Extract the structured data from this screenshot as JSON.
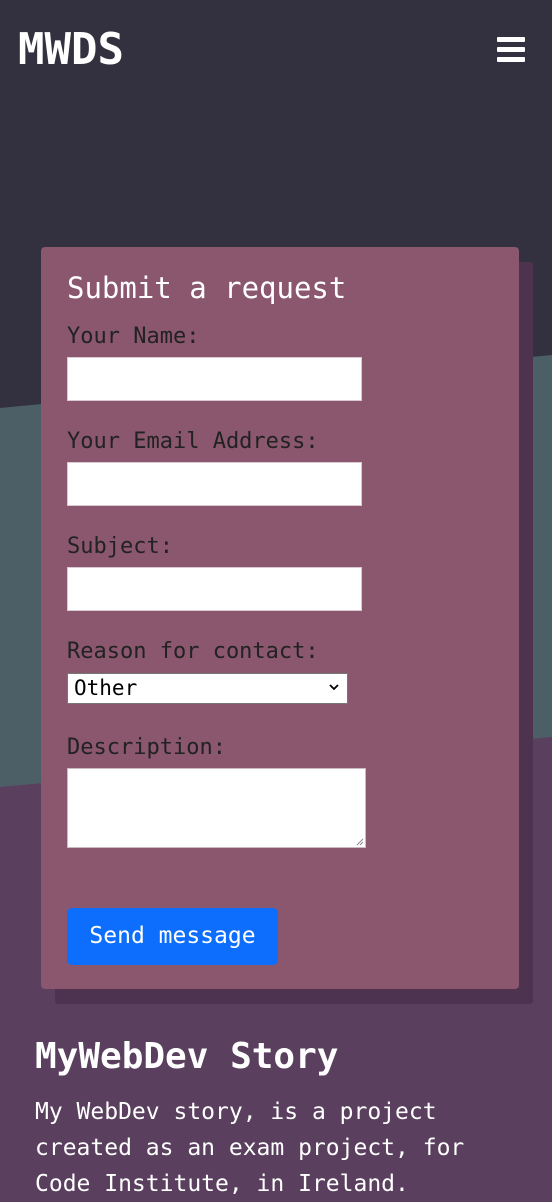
{
  "header": {
    "logo": "MWDS",
    "menu_icon": "hamburger-menu-icon"
  },
  "form": {
    "title": "Submit a request",
    "name_label": "Your Name:",
    "email_label": "Your Email Address:",
    "subject_label": "Subject:",
    "reason_label": "Reason for contact:",
    "reason_selected": "Other",
    "description_label": "Description:",
    "send_label": "Send message",
    "send_color": "#0d6efd"
  },
  "story": {
    "title": "MyWebDev Story",
    "text": "My WebDev story, is a project created as an exam project, for Code Institute, in Ireland."
  },
  "colors": {
    "header_bg": "#33313f",
    "teal_band": "#4d5f66",
    "bottom_bg": "#5a3f5e",
    "card_bg": "#8a576e"
  }
}
